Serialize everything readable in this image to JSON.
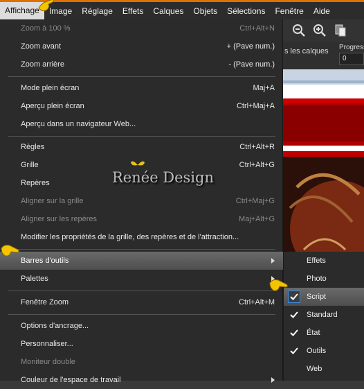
{
  "menubar": {
    "items": [
      "Affichage",
      "Image",
      "Réglage",
      "Effets",
      "Calques",
      "Objets",
      "Sélections",
      "Fenêtre",
      "Aide"
    ]
  },
  "toolbar": {
    "layers_text": "s les calques",
    "progress_label": "Progress",
    "progress_value": "0"
  },
  "menu": {
    "items": [
      {
        "label": "Zoom à 100 %",
        "shortcut": "Ctrl+Alt+N",
        "disabled": true
      },
      {
        "label": "Zoom avant",
        "shortcut": "+ (Pave num.)",
        "disabled": false
      },
      {
        "label": "Zoom arrière",
        "shortcut": "- (Pave num.)",
        "disabled": false
      },
      {
        "label": "Mode plein écran",
        "shortcut": "Maj+A",
        "disabled": false
      },
      {
        "label": "Aperçu plein écran",
        "shortcut": "Ctrl+Maj+A",
        "disabled": false
      },
      {
        "label": "Aperçu dans un navigateur Web...",
        "shortcut": "",
        "disabled": false
      },
      {
        "label": "Règles",
        "shortcut": "Ctrl+Alt+R",
        "disabled": false
      },
      {
        "label": "Grille",
        "shortcut": "Ctrl+Alt+G",
        "disabled": false
      },
      {
        "label": "Repères",
        "shortcut": "",
        "disabled": false
      },
      {
        "label": "Aligner sur la grille",
        "shortcut": "Ctrl+Maj+G",
        "disabled": true
      },
      {
        "label": "Aligner sur les repères",
        "shortcut": "Maj+Alt+G",
        "disabled": true
      },
      {
        "label": "Modifier les propriétés de la grille, des repères et de l'attraction...",
        "shortcut": "",
        "disabled": false
      },
      {
        "label": "Barres d'outils",
        "shortcut": "",
        "disabled": false
      },
      {
        "label": "Palettes",
        "shortcut": "",
        "disabled": false
      },
      {
        "label": "Fenêtre Zoom",
        "shortcut": "Ctrl+Alt+M",
        "disabled": false
      },
      {
        "label": "Options d'ancrage...",
        "shortcut": "",
        "disabled": false
      },
      {
        "label": "Personnaliser...",
        "shortcut": "",
        "disabled": false
      },
      {
        "label": "Moniteur double",
        "shortcut": "",
        "disabled": true
      },
      {
        "label": "Couleur de l'espace de travail",
        "shortcut": "",
        "disabled": false
      }
    ]
  },
  "submenu": {
    "items": [
      {
        "label": "Effets",
        "checked": false
      },
      {
        "label": "Photo",
        "checked": false
      },
      {
        "label": "Script",
        "checked": true
      },
      {
        "label": "Standard",
        "checked": true
      },
      {
        "label": "État",
        "checked": true
      },
      {
        "label": "Outils",
        "checked": true
      },
      {
        "label": "Web",
        "checked": false
      }
    ]
  },
  "watermark": "Renée Design",
  "colors": {
    "accent": "#e07000",
    "menu_bg": "#2b2b2b",
    "highlight": "#5c5c5c",
    "check_border": "#3a8ee6"
  }
}
